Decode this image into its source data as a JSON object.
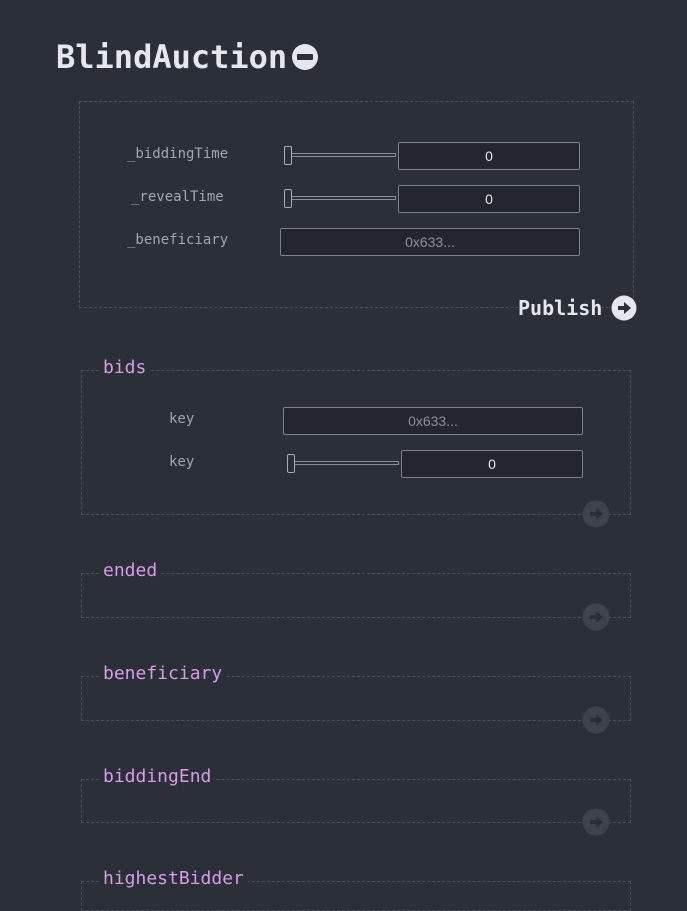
{
  "contract": {
    "name": "BlindAuction",
    "collapse_icon": "minus-circle-icon"
  },
  "constructor": {
    "params": [
      {
        "name": "_biddingTime",
        "type": "slider-number",
        "value": "0",
        "slider_fraction": 0
      },
      {
        "name": "_revealTime",
        "type": "slider-number",
        "value": "0",
        "slider_fraction": 0
      },
      {
        "name": "_beneficiary",
        "type": "address",
        "placeholder": "0x633..."
      }
    ],
    "publish_label": "Publish",
    "publish_icon": "arrow-right-circle-icon"
  },
  "functions": [
    {
      "name": "bids",
      "params": [
        {
          "name": "key",
          "type": "address",
          "placeholder": "0x633..."
        },
        {
          "name": "key",
          "type": "slider-number",
          "value": "0",
          "slider_fraction": 0
        }
      ],
      "run_icon": "arrow-right-circle-icon"
    },
    {
      "name": "ended",
      "params": [],
      "run_icon": "arrow-right-circle-icon"
    },
    {
      "name": "beneficiary",
      "params": [],
      "run_icon": "arrow-right-circle-icon"
    },
    {
      "name": "biddingEnd",
      "params": [],
      "run_icon": "arrow-right-circle-icon"
    },
    {
      "name": "highestBidder",
      "params": [],
      "run_icon": "arrow-right-circle-icon"
    }
  ],
  "colors": {
    "background": "#2b2f38",
    "title": "#e6e7ea",
    "function_name": "#d99be8",
    "dashed_border": "#4b505a",
    "run_icon_inactive": "#3f434b"
  }
}
